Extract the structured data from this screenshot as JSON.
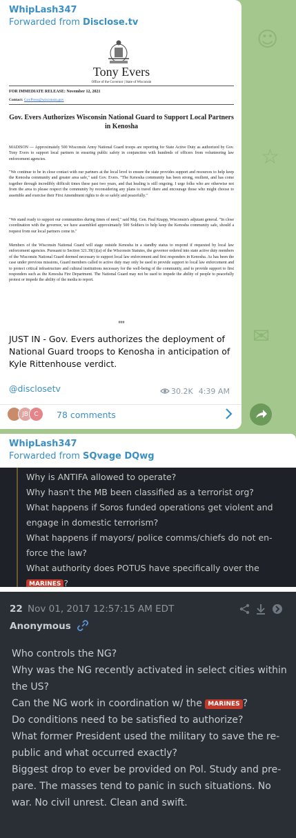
{
  "message1": {
    "sender": "WhipLash347",
    "forwarded_prefix": "Forwarded from ",
    "forwarded_source": "Disclose.tv",
    "document": {
      "name": "Tony Evers",
      "office_line": "Office of the Governor | State of Wisconsin",
      "release": "FOR IMMEDIATE RELEASE: November 12, 2021",
      "contact_label": "Contact: ",
      "contact_email": "GovPress@wisconsin.gov",
      "headline": "Gov. Evers Authorizes Wisconsin National Guard to Support Local Partners in Kenosha",
      "paragraphs": [
        "MADISON — Approximately 500 Wisconsin Army National Guard troops are reporting for State Active Duty as authorized by Gov. Tony Evers to support local partners in ensuring public safety in conjunction with hundreds of officers from volunteering law enforcement agencies.",
        "\"We continue to be in close contact with our partners at the local level to ensure the state provides support and resources to help keep the Kenosha community and greater area safe,\" said Gov. Evers. \"The Kenosha community has been strong, resilient, and has come together through incredibly difficult times these past two years, and that healing is still ongoing. I urge folks who are otherwise not from the area to please respect the community by reconsidering any plans to travel there and encourage those who might choose to assemble and exercise their First Amendment rights to do so safely and peacefully.\"",
        "\"We stand ready to support our communities during times of need,\" said Maj. Gen. Paul Knapp, Wisconsin's adjutant general. \"In close coordination with the governor, we have assembled approximately 500 Soldiers to help keep the Kenosha community safe, should a request from our local partners come in.\"",
        "Members of the Wisconsin National Guard will stage outside Kenosha in a standby status to respond if requested by local law enforcement agencies. Pursuant to Section 321.39(1)(a) of the Wisconsin Statutes, the governor ordered into state active duty members of the Wisconsin National Guard deemed necessary to support local law enforcement and first responders in Kenosha. As has been the case under previous missions, Guard members called to active duty may only be used to provide support to local law enforcement and to protect critical infrastructure and cultural institutions necessary for the well-being of the community, and to provide support to first responders such as the Kenosha Fire Department. The National Guard may not be used to impede the ability of people to peacefully protest or impede the ability of the media to report."
      ],
      "end_mark": "###"
    },
    "caption": "JUST IN - Gov. Evers authorizes the deployment of National Guard troops to Kenosha in anticipation of Kyle Rittenhouse verdict.",
    "via": "@disclosetv",
    "views": "30.2K",
    "time": "4:39 AM",
    "avatar_initials": [
      "JB",
      "C"
    ],
    "comments": "78 comments"
  },
  "message2": {
    "sender": "WhipLash347",
    "forwarded_prefix": "Forwarded from ",
    "forwarded_source": "SQvage DQwg",
    "questions": [
      "Why is ANTIFA allowed to operate?",
      "Why hasn't the MB been classified as a terrorist org?",
      "What happens if Soros funded operations get violent and engage in domestic terrorism?",
      "What happens if mayors/ police comms/chiefs do not en-force the law?",
      "What authority does POTUS have specifically over the"
    ],
    "badge": "MARINES",
    "question_end": "?",
    "post": {
      "number": "22",
      "date": "Nov 01, 2017 12:57:15 AM EDT",
      "author": "Anonymous",
      "lines_before": [
        "Who controls the NG?",
        "Why was the NG recently activated in select cities within the US?"
      ],
      "line_with_badge_prefix": "Can the NG work in coordination w/ the ",
      "line_with_badge_suffix": "?",
      "lines_after": [
        "Do conditions need to be satisfied to authorize?",
        "What former President used the military to save the re-public and what occurred exactly?",
        "Biggest drop to ever be provided on Pol. Study and pre-pare. The masses tend to panic in such situations. No war. No civil unrest. Clean and swift."
      ]
    }
  },
  "colors": {
    "chat_background": "#a3c78d",
    "link_blue": "#3a8fc4",
    "badge_red": "#c0392b",
    "dark_panel": "#2a2f36"
  },
  "icons": [
    "eye-icon",
    "chevron-right-icon",
    "share-arrow-icon",
    "link-icon",
    "share-icon",
    "download-icon",
    "circle-arrow-icon"
  ]
}
